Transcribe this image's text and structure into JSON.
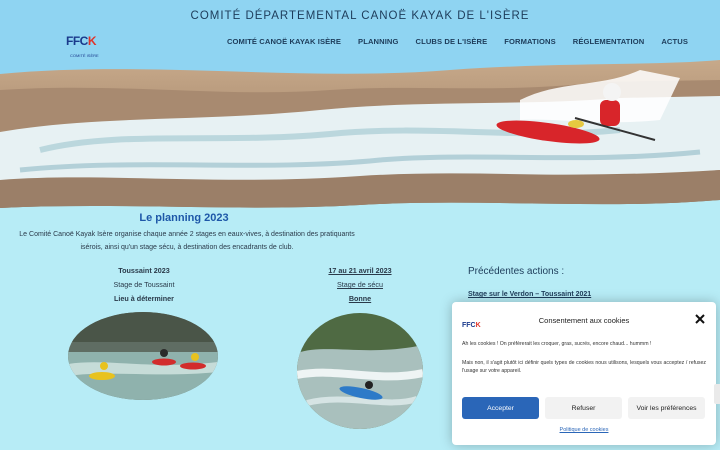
{
  "header": {
    "site_title": "COMITÉ DÉPARTEMENTAL CANOË KAYAK DE L'ISÈRE",
    "logo_text_a": "FFC",
    "logo_text_b": "K",
    "logo_sub": "COMITÉ ISÈRE",
    "nav": [
      "COMITÉ CANOË KAYAK ISÈRE",
      "PLANNING",
      "CLUBS DE L'ISÈRE",
      "FORMATIONS",
      "RÉGLEMENTATION",
      "ACTUS"
    ]
  },
  "intro": {
    "title": "Le planning 2023",
    "text": "Le Comité Canoë Kayak Isère organise chaque année 2 stages en eaux-vives, à destination des pratiquants isérois, ainsi qu'un stage sécu, à destination des encadrants de club."
  },
  "events": [
    {
      "date": "Toussaint 2023",
      "name": "Stage de Toussaint",
      "place": "Lieu à déterminer"
    },
    {
      "date": "17 au 21 avril 2023",
      "name": "Stage de sécu",
      "place": "Bonne"
    }
  ],
  "actions": {
    "title": "Précédentes actions :",
    "link": "Stage sur le Verdon – Toussaint 2021"
  },
  "cookie": {
    "title": "Consentement aux cookies",
    "text1": "Ah les cookies ! On préfèrerait les croquer, gras, sucrés, encore chaud... hummm !",
    "text2": "Mais non, il s'agit plutôt ici définir quels types de cookies nous utilisons, lesquels vous acceptez / refusez l'usage sur votre appareil.",
    "accept": "Accepter",
    "refuse": "Refuser",
    "prefs": "Voir les préférences",
    "policy": "Politique de cookies"
  },
  "colors": {
    "header_bg": "#8fd4f2",
    "page_bg": "#b7ecf6",
    "accent_blue": "#2a66b8",
    "title_blue": "#1d57a8"
  }
}
